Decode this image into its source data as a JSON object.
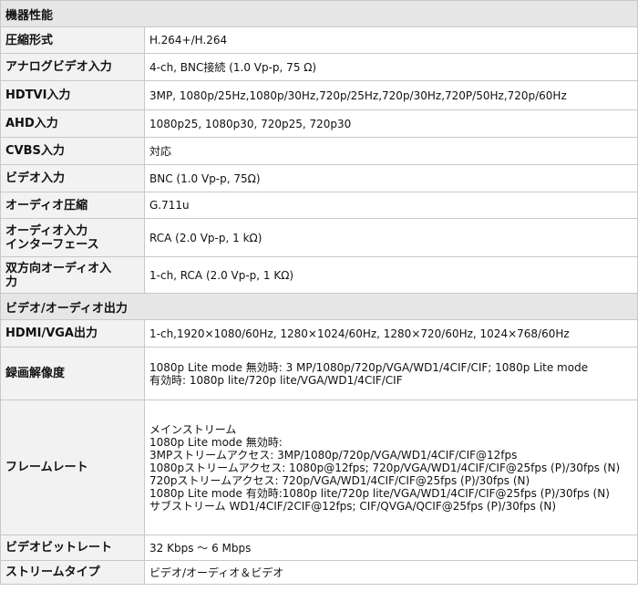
{
  "section_device": "機器性能",
  "device_rows": [
    {
      "label": "圧縮形式",
      "value": "H.264+/H.264"
    },
    {
      "label": "アナログビデオ入力",
      "value": "4-ch, BNC接続 (1.0 Vp-p, 75 Ω)"
    },
    {
      "label": "HDTVI入力",
      "value": "3MP, 1080p/25Hz,1080p/30Hz,720p/25Hz,720p/30Hz,720P/50Hz,720p/60Hz"
    },
    {
      "label": "AHD入力",
      "value": "1080p25, 1080p30, 720p25, 720p30"
    },
    {
      "label": "CVBS入力",
      "value": "対応"
    },
    {
      "label": "ビデオ入力",
      "value": "BNC (1.0 Vp-p, 75Ω)"
    },
    {
      "label": "オーディオ圧縮",
      "value": "G.711u"
    },
    {
      "label": "オーディオ入力\nインターフェース",
      "value": "RCA (2.0 Vp-p, 1 kΩ)"
    },
    {
      "label": "双方向オーディオ入\n力",
      "value": "1-ch, RCA (2.0 Vp-p, 1 KΩ)"
    }
  ],
  "section_av": "ビデオ/オーディオ出力",
  "av_rows": [
    {
      "label": "HDMI/VGA出力",
      "value": "1-ch,1920×1080/60Hz, 1280×1024/60Hz, 1280×720/60Hz, 1024×768/60Hz"
    },
    {
      "label": "録画解像度",
      "value": "1080p Lite mode 無効時: 3 MP/1080p/720p/VGA/WD1/4CIF/CIF; 1080p Lite mode\n有効時: 1080p lite/720p lite/VGA/WD1/4CIF/CIF"
    },
    {
      "label": "フレームレート",
      "value": "メインストリーム\n1080p Lite mode 無効時:\n3MPストリームアクセス: 3MP/1080p/720p/VGA/WD1/4CIF/CIF@12fps\n1080pストリームアクセス: 1080p@12fps; 720p/VGA/WD1/4CIF/CIF@25fps (P)/30fps (N)\n720pストリームアクセス: 720p/VGA/WD1/4CIF/CIF@25fps (P)/30fps (N)\n1080p Lite mode 有効時:1080p lite/720p lite/VGA/WD1/4CIF/CIF@25fps (P)/30fps (N)\nサブストリーム WD1/4CIF/2CIF@12fps; CIF/QVGA/QCIF@25fps (P)/30fps (N)"
    },
    {
      "label": "ビデオビットレート",
      "value": "32 Kbps ～ 6 Mbps"
    },
    {
      "label": "ストリームタイプ",
      "value": "ビデオ/オーディオ＆ビデオ"
    }
  ]
}
